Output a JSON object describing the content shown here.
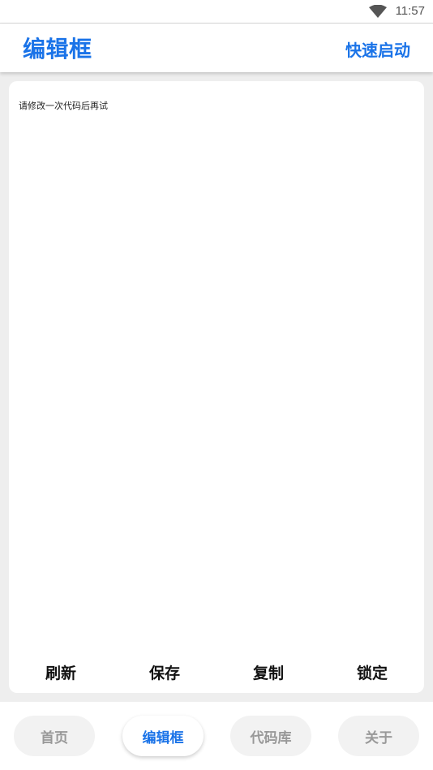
{
  "status_bar": {
    "time": "11:57",
    "icons": [
      "wifi-icon"
    ]
  },
  "header": {
    "title": "编辑框",
    "quick_start_label": "快速启动"
  },
  "editor": {
    "content": "请修改一次代码后再试",
    "actions": [
      "刷新",
      "保存",
      "复制",
      "锁定"
    ]
  },
  "bottom_nav": {
    "items": [
      "首页",
      "编辑框",
      "代码库",
      "关于"
    ],
    "active": "编辑框"
  },
  "colors": {
    "accent": "#1a73e8",
    "background": "#eeeeee",
    "inactive_tab": "#999999"
  }
}
